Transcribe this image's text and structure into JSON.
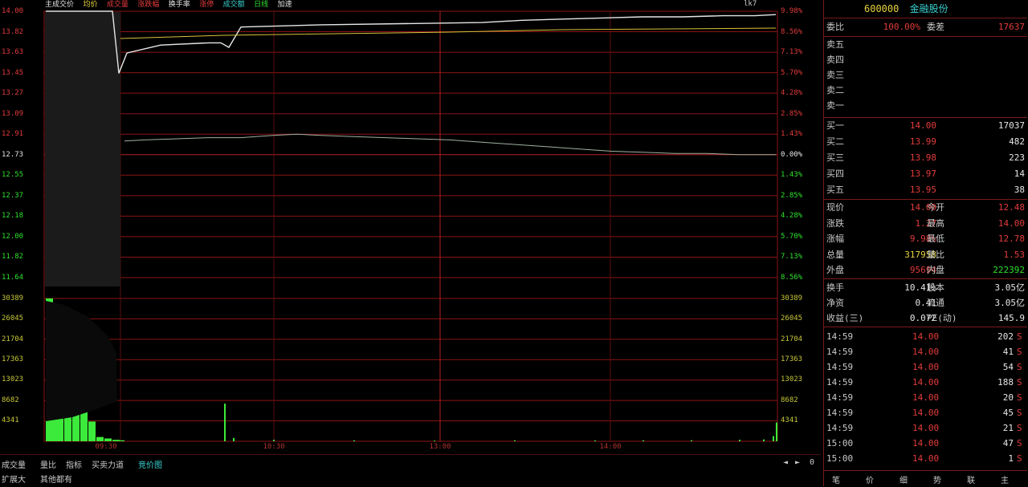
{
  "chart": {
    "top_info": [
      "主成交价",
      "均价",
      "成交量",
      "涨跌幅",
      "换手率",
      "涨停",
      "成交额",
      "日线",
      "加速"
    ],
    "top_right_label": "lk7",
    "price_left": [
      "14.00",
      "13.82",
      "13.63",
      "13.45",
      "13.27",
      "13.09",
      "12.91",
      "12.73",
      "12.55",
      "12.37",
      "12.18",
      "12.00",
      "11.82",
      "11.64"
    ],
    "pct_right": [
      "9.98%",
      "8.56%",
      "7.13%",
      "5.70%",
      "4.28%",
      "2.85%",
      "1.43%",
      "0.00%",
      "1.43%",
      "2.85%",
      "4.28%",
      "5.70%",
      "7.13%",
      "8.56%"
    ],
    "vol_left": [
      "30389",
      "26045",
      "21704",
      "17363",
      "13023",
      "8682",
      "4341"
    ],
    "vol_right": [
      "30389",
      "26045",
      "21704",
      "17363",
      "13023",
      "8682",
      "4341"
    ],
    "time_labels": [
      "09:30",
      "10:30",
      "13:00",
      "14:00"
    ],
    "price_line_values": [
      14.0,
      14.0,
      14.0,
      14.0,
      13.45,
      13.63,
      13.7,
      13.72,
      13.72,
      13.68,
      13.86,
      13.88,
      13.89,
      13.9,
      13.92,
      13.93,
      13.94,
      13.95,
      13.95,
      13.96,
      13.96,
      13.97
    ],
    "avg_line_values": [
      12.85,
      12.86,
      12.87,
      12.88,
      12.88,
      12.9,
      12.91,
      12.9,
      12.89,
      12.88,
      12.87,
      12.86,
      12.84,
      12.82,
      12.8,
      12.78,
      12.76,
      12.75,
      12.74,
      12.74,
      12.73,
      12.73
    ],
    "tick_volume_values": [
      30389,
      26000,
      24000,
      20000,
      16000,
      9000,
      4200,
      900,
      600,
      300,
      200,
      200,
      8000,
      700,
      300,
      200,
      150,
      200,
      180,
      200,
      220,
      300,
      400,
      1100,
      4000
    ]
  },
  "bottom": {
    "tabs": [
      "成交量",
      "量比",
      "指标",
      "买卖力道",
      "竞价图"
    ],
    "row2": [
      "扩展大",
      "其他都有"
    ],
    "arrows": [
      "◄",
      "►",
      "0"
    ]
  },
  "panel": {
    "code": "600000",
    "name": "金融股份",
    "header": {
      "label": "委比",
      "value": "100.00%",
      "mid": "委差",
      "right": "17637"
    },
    "sell": [
      {
        "label": "卖五",
        "price": "",
        "vol": ""
      },
      {
        "label": "卖四",
        "price": "",
        "vol": ""
      },
      {
        "label": "卖三",
        "price": "",
        "vol": ""
      },
      {
        "label": "卖二",
        "price": "",
        "vol": ""
      },
      {
        "label": "卖一",
        "price": "",
        "vol": ""
      }
    ],
    "buy": [
      {
        "label": "买一",
        "price": "14.00",
        "vol": "17037"
      },
      {
        "label": "买二",
        "price": "13.99",
        "vol": "482"
      },
      {
        "label": "买三",
        "price": "13.98",
        "vol": "223"
      },
      {
        "label": "买四",
        "price": "13.97",
        "vol": "14"
      },
      {
        "label": "买五",
        "price": "13.95",
        "vol": "38"
      }
    ],
    "stats": [
      {
        "l1": "现价",
        "v1": "14.00",
        "l2": "今开",
        "v2": "12.48"
      },
      {
        "l1": "涨跌",
        "v1": "1.27",
        "l2": "最高",
        "v2": "14.00"
      },
      {
        "l1": "涨幅",
        "v1": "9.98%",
        "l2": "最低",
        "v2": "12.78"
      },
      {
        "l1": "总量",
        "v1": "317958",
        "l2": "量比",
        "v2": "1.53"
      },
      {
        "l1": "外盘",
        "v1": "95694",
        "l2": "内盘",
        "v2": "222392"
      }
    ],
    "stats2": [
      {
        "l1": "换手",
        "v1": "10.41%",
        "l2": "股本",
        "v2": "3.05亿"
      },
      {
        "l1": "净资",
        "v1": "0.41",
        "l2": "流通",
        "v2": "3.05亿"
      },
      {
        "l1": "收益(三)",
        "v1": "0.072",
        "l2": "PE(动)",
        "v2": "145.9"
      }
    ],
    "ticks": [
      {
        "time": "14:59",
        "price": "14.00",
        "vol": "202",
        "flag": "S"
      },
      {
        "time": "14:59",
        "price": "14.00",
        "vol": "41",
        "flag": "S"
      },
      {
        "time": "14:59",
        "price": "14.00",
        "vol": "54",
        "flag": "S"
      },
      {
        "time": "14:59",
        "price": "14.00",
        "vol": "188",
        "flag": "S"
      },
      {
        "time": "14:59",
        "price": "14.00",
        "vol": "20",
        "flag": "S"
      },
      {
        "time": "14:59",
        "price": "14.00",
        "vol": "45",
        "flag": "S"
      },
      {
        "time": "14:59",
        "price": "14.00",
        "vol": "21",
        "flag": "S"
      },
      {
        "time": "15:00",
        "price": "14.00",
        "vol": "47",
        "flag": "S"
      },
      {
        "time": "15:00",
        "price": "14.00",
        "vol": "1",
        "flag": "S"
      }
    ],
    "footer_tabs": [
      "笔",
      "价",
      "细",
      "势",
      "联",
      "主"
    ]
  },
  "colors": {
    "grid_red": "#8b1414",
    "grid_mid": "#5a0d0d",
    "price_line": "#e6e6e6",
    "avg_line": "#d9c23a",
    "vol_green": "#3bea3b"
  }
}
